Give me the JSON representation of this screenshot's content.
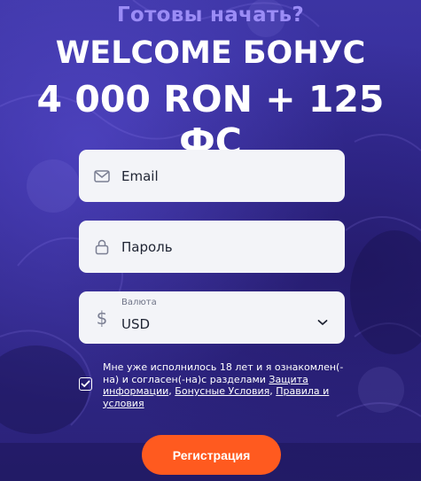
{
  "header": {
    "subtitle": "Готовы начать?",
    "title_line1": "WELCOME БОНУС",
    "title_line2": "4 000 RON + 125 ФС"
  },
  "form": {
    "email": {
      "placeholder": "Email",
      "icon": "mail-icon"
    },
    "password": {
      "placeholder": "Пароль",
      "icon": "lock-icon"
    },
    "currency": {
      "label": "Валюта",
      "value": "USD",
      "icon": "dollar-icon"
    }
  },
  "consent": {
    "text_before": "Мне уже исполнилось 18 лет и я ознакомлен(-на) и согласен(-на)с разделами ",
    "link1": "Защита информации",
    "sep1": ", ",
    "link2": "Бонусные Условия",
    "sep2": ", ",
    "link3": "Правила и условия",
    "checked": true
  },
  "register_button": {
    "label": "Регистрация"
  },
  "colors": {
    "accent": "#ff5a1f",
    "subtitle": "#9b8cf6",
    "background": "#2f2684",
    "field_bg": "#f3f4f8"
  }
}
